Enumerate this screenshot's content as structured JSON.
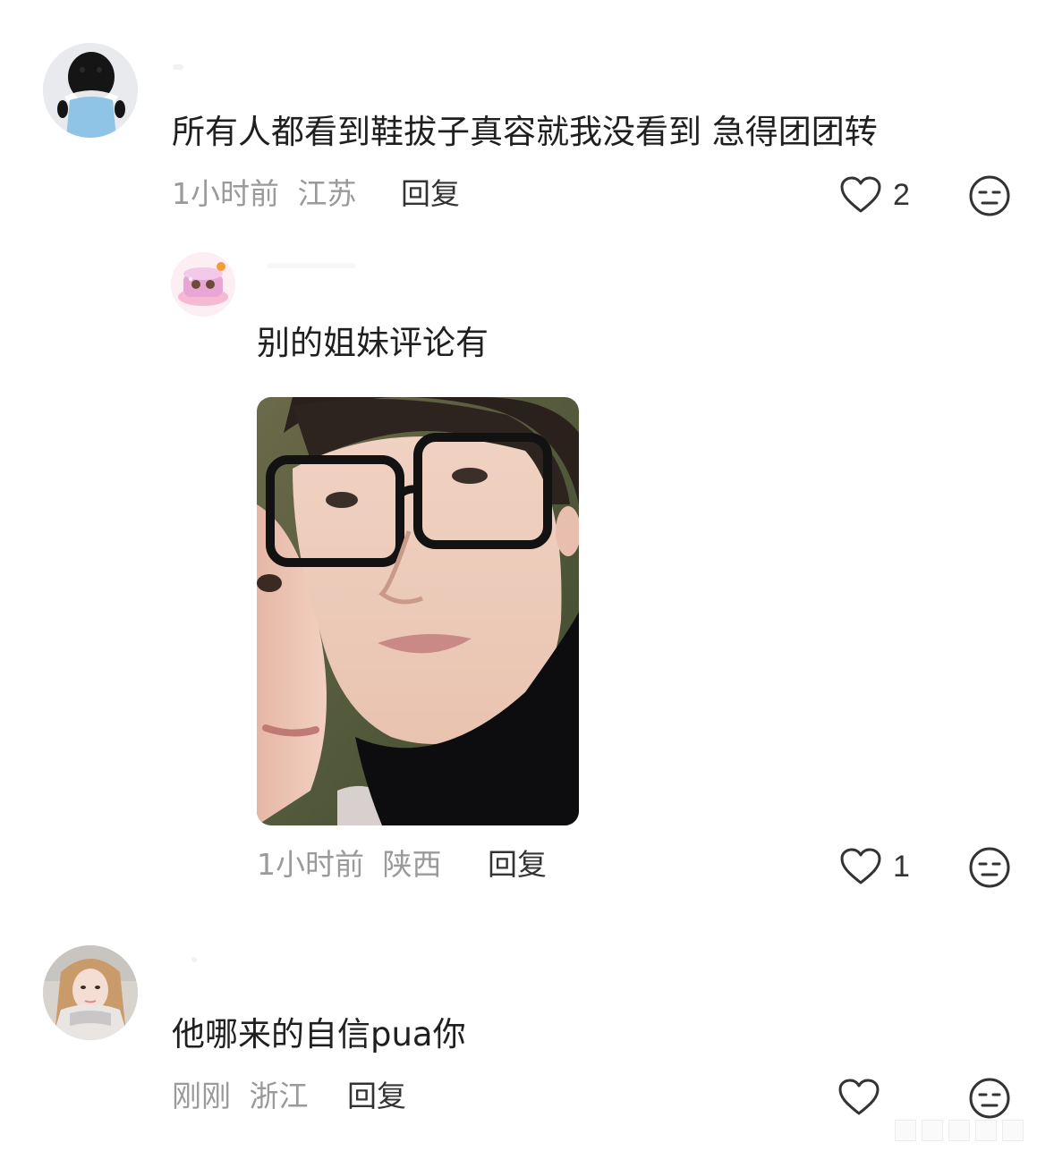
{
  "comments": [
    {
      "text": "所有人都看到鞋拔子真容就我没看到 急得团团转",
      "time": "1小时前",
      "location": "江苏",
      "reply_label": "回复",
      "likes": "2",
      "avatar_icon": "plush-doll-avatar-icon"
    },
    {
      "text": "别的姐妹评论有",
      "time": "1小时前",
      "location": "陕西",
      "reply_label": "回复",
      "likes": "1",
      "avatar_icon": "cake-sticker-avatar-icon",
      "has_image": true
    },
    {
      "text": "他哪来的自信pua你",
      "time": "刚刚",
      "location": "浙江",
      "reply_label": "回复",
      "likes": "",
      "avatar_icon": "girl-selfie-avatar-icon"
    }
  ],
  "colors": {
    "text": "#1f1f1f",
    "meta": "#9a9a9a",
    "icon": "#333333"
  }
}
